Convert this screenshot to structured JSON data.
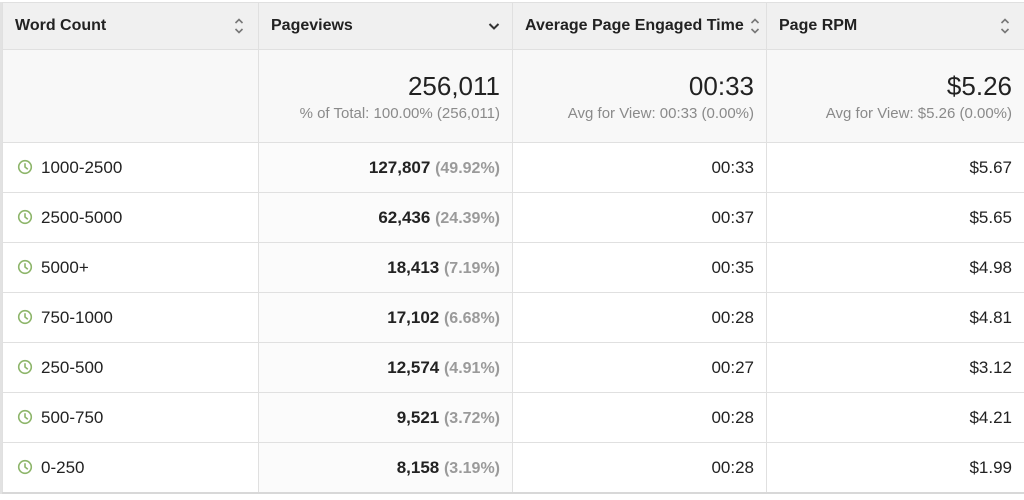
{
  "columns": [
    {
      "label": "Word Count",
      "sort_icon": "sort-both-icon"
    },
    {
      "label": "Pageviews",
      "sort_icon": "sort-desc-icon"
    },
    {
      "label": "Average Page Engaged Time",
      "sort_icon": "sort-both-icon"
    },
    {
      "label": "Page RPM",
      "sort_icon": "sort-both-icon"
    }
  ],
  "summary": {
    "pageviews": {
      "value": "256,011",
      "sub": "% of Total: 100.00% (256,011)"
    },
    "engaged_time": {
      "value": "00:33",
      "sub": "Avg for View: 00:33 (0.00%)"
    },
    "rpm": {
      "value": "$5.26",
      "sub": "Avg for View: $5.26 (0.00%)"
    }
  },
  "rows": [
    {
      "word_count": "1000-2500",
      "pageviews": "127,807",
      "pct": "(49.92%)",
      "time": "00:33",
      "rpm": "$5.67"
    },
    {
      "word_count": "2500-5000",
      "pageviews": "62,436",
      "pct": "(24.39%)",
      "time": "00:37",
      "rpm": "$5.65"
    },
    {
      "word_count": "5000+",
      "pageviews": "18,413",
      "pct": "(7.19%)",
      "time": "00:35",
      "rpm": "$4.98"
    },
    {
      "word_count": "750-1000",
      "pageviews": "17,102",
      "pct": "(6.68%)",
      "time": "00:28",
      "rpm": "$4.81"
    },
    {
      "word_count": "250-500",
      "pageviews": "12,574",
      "pct": "(4.91%)",
      "time": "00:27",
      "rpm": "$3.12"
    },
    {
      "word_count": "500-750",
      "pageviews": "9,521",
      "pct": "(3.72%)",
      "time": "00:28",
      "rpm": "$4.21"
    },
    {
      "word_count": "0-250",
      "pageviews": "8,158",
      "pct": "(3.19%)",
      "time": "00:28",
      "rpm": "$1.99"
    }
  ],
  "colors": {
    "clock_icon": "#8db56a",
    "header_bg": "#f0f0f0",
    "percent_text": "#9a9a9a"
  }
}
